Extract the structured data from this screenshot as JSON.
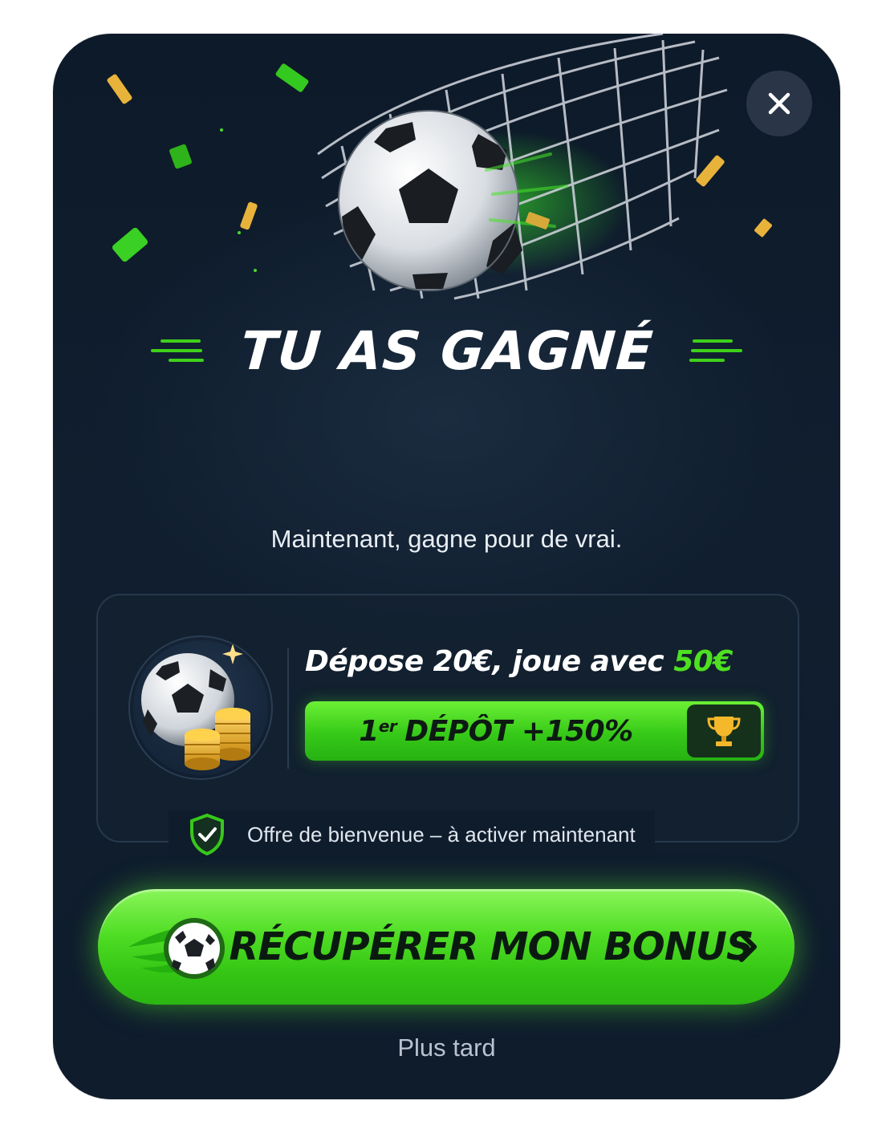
{
  "dialog": {
    "close_icon": "close-icon",
    "title": "TU AS GAGNÉ",
    "subtitle": "Maintenant, gagne pour de vrai.",
    "offer": {
      "headline_main": "Dépose 20€, joue avec ",
      "headline_accent": "50€",
      "badge_prefix": "1",
      "badge_sup": "er",
      "badge_rest": "DÉPÔT +150%",
      "badge_icon": "trophy-icon",
      "image_icon": "soccer-ball-coins-icon"
    },
    "welcome": {
      "icon": "shield-check-icon",
      "text": "Offre de bienvenue – à activer maintenant"
    },
    "cta": {
      "label": "RÉCUPÉRER MON BONUS",
      "icon": "flaming-soccer-ball-icon",
      "chevron": "chevron-right-icon"
    },
    "later_label": "Plus tard"
  },
  "colors": {
    "background": "#0f1c2c",
    "accent_green": "#4ee021",
    "cta_green": "#3fd01a",
    "gold": "#f5b82a"
  }
}
